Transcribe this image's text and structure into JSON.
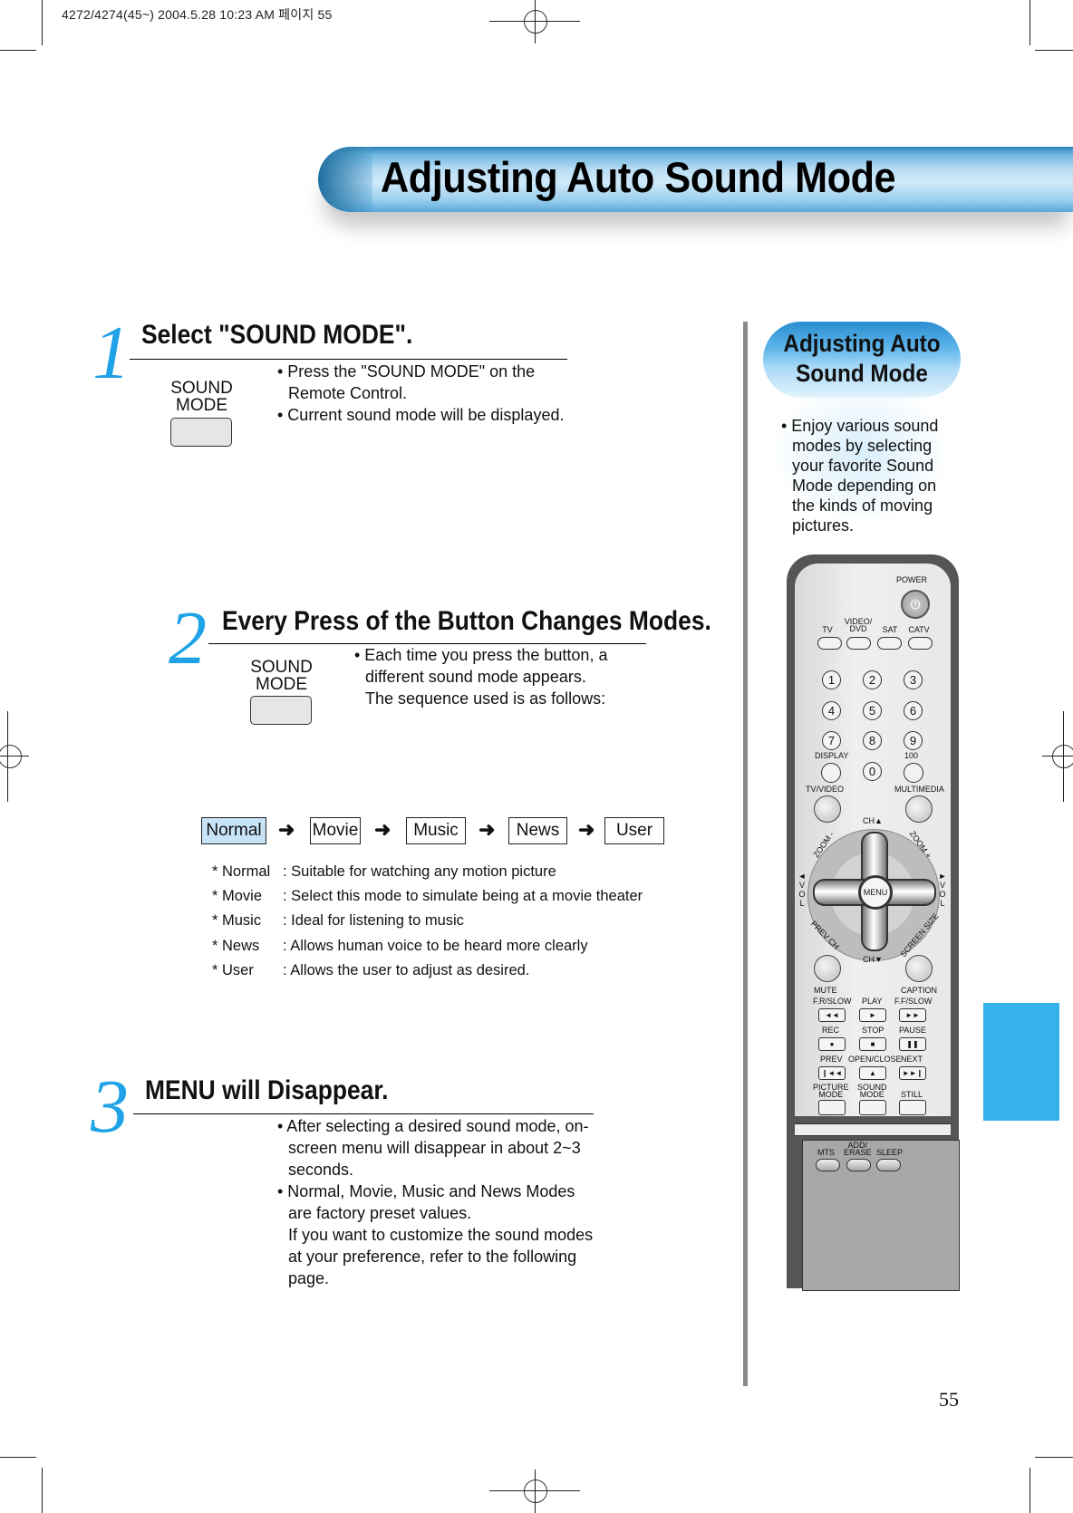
{
  "print_header": "4272/4274(45~)  2004.5.28 10:23 AM 페이지 55",
  "page": {
    "title": "Adjusting Auto Sound Mode",
    "number": "55"
  },
  "steps": [
    {
      "number": "1",
      "title": "Select \"SOUND MODE\".",
      "button_label_line1": "SOUND",
      "button_label_line2": "MODE",
      "bullets": [
        "• Press the \"SOUND MODE\" on the Remote Control.",
        "• Current sound mode will be displayed."
      ]
    },
    {
      "number": "2",
      "title": "Every Press of the Button Changes Modes.",
      "button_label_line1": "SOUND",
      "button_label_line2": "MODE",
      "bullets": [
        "• Each time you press the button, a different sound mode appears.",
        "The sequence used is as follows:"
      ]
    },
    {
      "number": "3",
      "title": "MENU will Disappear.",
      "bullets": [
        "• After selecting a desired sound mode, on-screen menu will disappear in about 2~3 seconds.",
        "• Normal, Movie, Music and News Modes are factory preset values.",
        "If you want to customize the sound modes at your preference, refer to the following page."
      ]
    }
  ],
  "sequence": {
    "modes": [
      "Normal",
      "Movie",
      "Music",
      "News",
      "User"
    ],
    "active": "Normal",
    "arrow_glyph": "➜",
    "active_color": "#c6e3f7"
  },
  "definitions": [
    {
      "term": "* Normal",
      "desc": ": Suitable for watching any motion picture"
    },
    {
      "term": "* Movie",
      "desc": ": Select this mode to simulate being at a movie theater"
    },
    {
      "term": "* Music",
      "desc": ": Ideal for listening to music"
    },
    {
      "term": "* News",
      "desc": ": Allows human voice to be heard more clearly"
    },
    {
      "term": "* User",
      "desc": ": Allows the user to adjust as desired."
    }
  ],
  "sidebar": {
    "title_line1": "Adjusting Auto",
    "title_line2": "Sound Mode",
    "text": "• Enjoy various sound modes by selecting your favorite Sound Mode depending on the kinds of moving pictures.",
    "accent_color": "#37b1ea"
  },
  "remote": {
    "power": "POWER",
    "power_icon": "⏻",
    "source_buttons": [
      "TV",
      "VIDEO/\nDVD",
      "SAT",
      "CATV"
    ],
    "digits": [
      "1",
      "2",
      "3",
      "4",
      "5",
      "6",
      "7",
      "8",
      "9",
      "0"
    ],
    "display": "DISPLAY",
    "hundred": "100",
    "tv_video": "TV/VIDEO",
    "multimedia": "MULTIMEDIA",
    "ch_up": "CH▲",
    "ch_down": "CH▼",
    "zoom_minus": "ZOOM -",
    "zoom_plus": "ZOOM +",
    "vol_left": "◄VOL",
    "vol_right": "►VOL",
    "menu": "MENU",
    "prev_ch": "PREV CH",
    "screen_size": "SCREEN SIZE",
    "mute": "MUTE",
    "caption": "CAPTION",
    "transport": [
      {
        "label": "F.R/SLOW",
        "glyph": "◄◄"
      },
      {
        "label": "PLAY",
        "glyph": "►"
      },
      {
        "label": "F.F/SLOW",
        "glyph": "►►"
      },
      {
        "label": "REC",
        "glyph": "●"
      },
      {
        "label": "STOP",
        "glyph": "■"
      },
      {
        "label": "PAUSE",
        "glyph": "❚❚"
      },
      {
        "label": "PREV",
        "glyph": "❙◄◄"
      },
      {
        "label": "OPEN/CLOSE",
        "glyph": "▲"
      },
      {
        "label": "NEXT",
        "glyph": "►►❙"
      }
    ],
    "mode_buttons": [
      "PICTURE\nMODE",
      "SOUND\nMODE",
      "STILL"
    ],
    "lower_buttons": [
      "MTS",
      "ADD/\nERASE",
      "SLEEP"
    ]
  }
}
